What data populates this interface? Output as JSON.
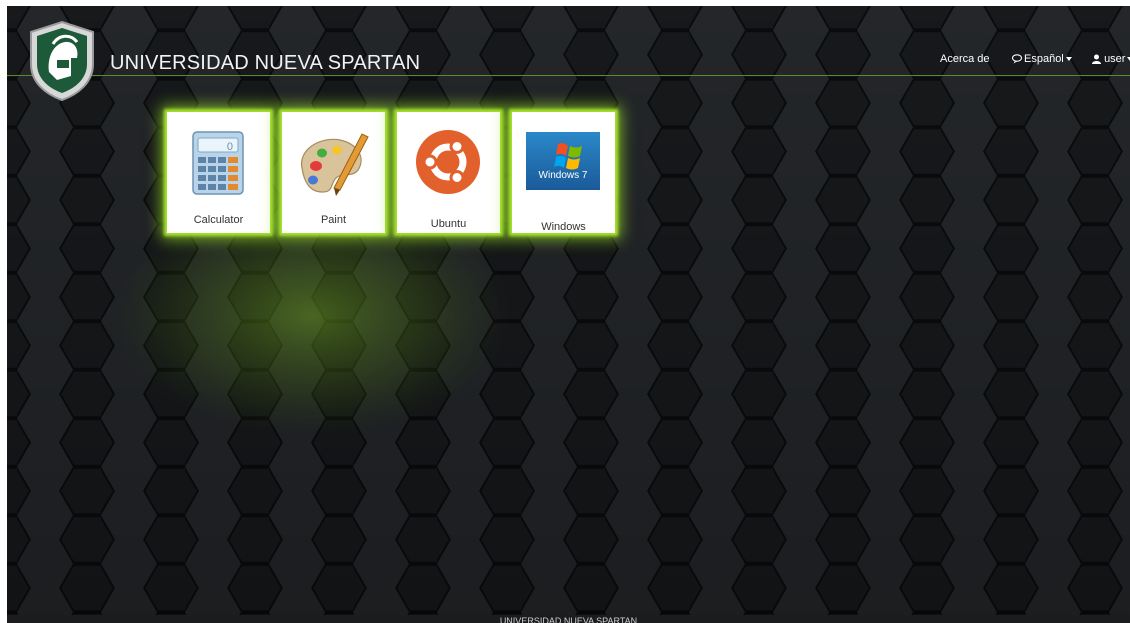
{
  "header": {
    "brand": "UNIVERSIDAD NUEVA SPARTAN",
    "nav": {
      "about": "Acerca de",
      "language": "Español",
      "user": "user"
    }
  },
  "apps": [
    {
      "label": "Calculator",
      "icon": "calculator-icon"
    },
    {
      "label": "Paint",
      "icon": "paint-palette-icon"
    },
    {
      "label": "Ubuntu",
      "icon": "ubuntu-logo-icon"
    },
    {
      "label": "Windows",
      "icon": "windows-7-logo-icon"
    }
  ],
  "footer": {
    "text": "UNIVERSIDAD NUEVA SPARTAN"
  },
  "colors": {
    "background": "#1e2124",
    "accent_glow": "#a6e22e",
    "logo_green": "#1d5a3a"
  }
}
